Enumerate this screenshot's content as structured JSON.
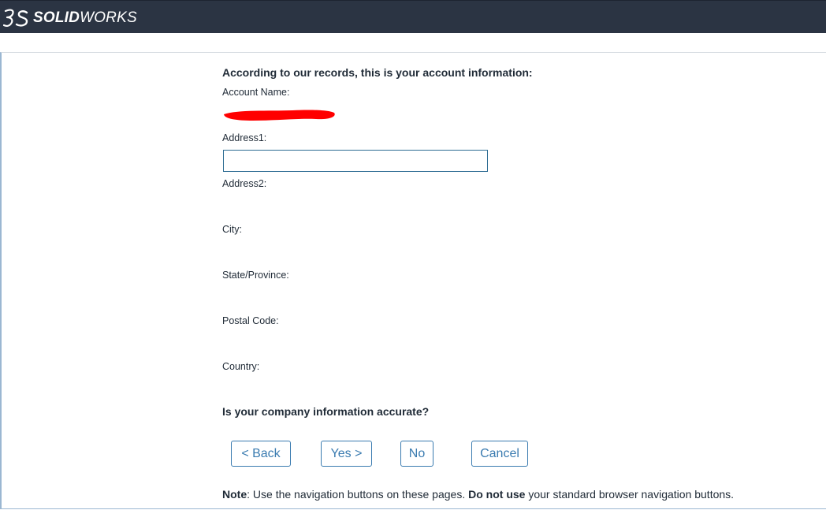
{
  "brand": {
    "name_bold": "SOLID",
    "name_light": "WORKS",
    "logo_icon": "ds-logo-icon"
  },
  "form": {
    "heading": "According to our records, this is your account information:",
    "account_name_label": "Account Name:",
    "address1_label": "Address1:",
    "address1_value": "",
    "address2_label": "Address2:",
    "city_label": "City:",
    "state_label": "State/Province:",
    "postal_label": "Postal Code:",
    "country_label": "Country:",
    "question": "Is your company information accurate?"
  },
  "buttons": {
    "back": "< Back",
    "yes": "Yes >",
    "no": "No",
    "cancel": "Cancel"
  },
  "note": {
    "label": "Note",
    "text1": ": Use the navigation buttons on these pages. ",
    "emphasis": "Do not use",
    "text2": " your standard browser navigation buttons."
  },
  "colors": {
    "topbar": "#2b3443",
    "button_accent": "#3a7bb0",
    "redaction": "#ff0000"
  }
}
